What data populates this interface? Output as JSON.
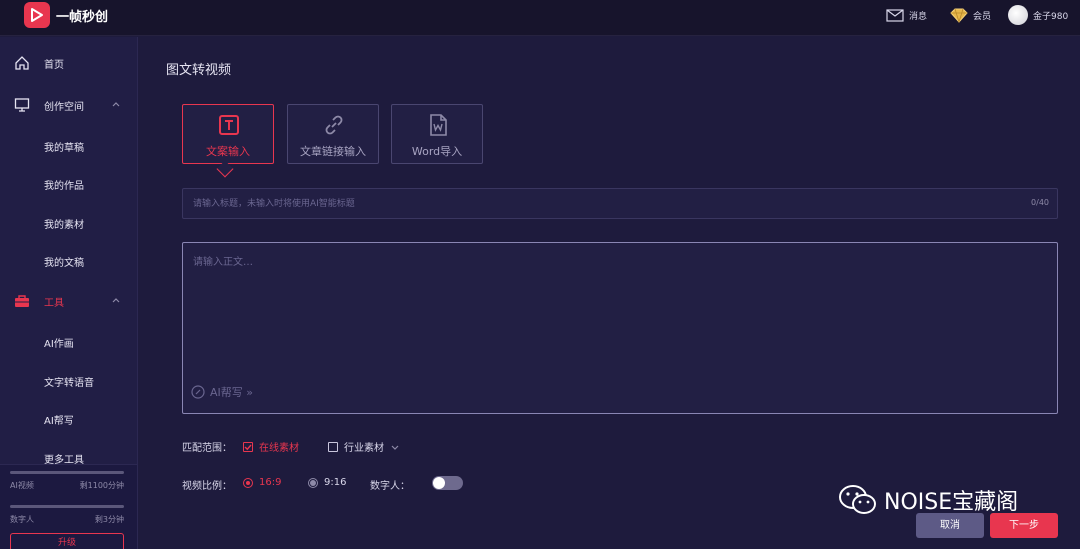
{
  "app": {
    "name": "一帧秒创"
  },
  "topbar": {
    "messages_label": "消息",
    "vip_label": "会员",
    "coins_label": "金子980"
  },
  "sidebar": {
    "items": [
      {
        "label": "首页",
        "icon": "home-icon"
      },
      {
        "label": "创作空间",
        "icon": "monitor-icon"
      },
      {
        "label": "我的草稿"
      },
      {
        "label": "我的作品"
      },
      {
        "label": "我的素材"
      },
      {
        "label": "我的文稿"
      },
      {
        "label": "工具",
        "icon": "toolbox-icon"
      },
      {
        "label": "AI作画"
      },
      {
        "label": "文字转语音"
      },
      {
        "label": "AI帮写"
      },
      {
        "label": "更多工具"
      }
    ],
    "quota": [
      {
        "label": "AI视频",
        "value": "剩1100分钟",
        "fill": 0.0
      },
      {
        "label": "数字人",
        "value": "剩3分钟",
        "fill": 0.0
      }
    ],
    "upgrade_label": "升级"
  },
  "main": {
    "title": "图文转视频",
    "tabs": [
      {
        "label": "文案输入",
        "icon": "text-icon",
        "active": true
      },
      {
        "label": "文章链接输入",
        "icon": "link-icon",
        "active": false
      },
      {
        "label": "Word导入",
        "icon": "word-file-icon",
        "active": false
      }
    ],
    "title_input": {
      "placeholder": "请输入标题，未输入时将使用AI智能标题",
      "count": "0/40"
    },
    "body_input": {
      "placeholder": "请输入正文…"
    },
    "ai_help_label": "AI帮写 »",
    "match_range": {
      "label": "匹配范围：",
      "options": [
        {
          "label": "在线素材",
          "checked": true
        },
        {
          "label": "行业素材",
          "checked": false
        }
      ]
    },
    "ratio": {
      "label": "视频比例：",
      "options": [
        {
          "label": "16:9",
          "selected": true
        },
        {
          "label": "9:16",
          "selected": false
        }
      ],
      "digital_human_label": "数字人：",
      "digital_human_on": false
    },
    "cancel_label": "取消",
    "next_label": "下一步"
  },
  "watermark": {
    "text": "NOISE宝藏阁"
  },
  "colors": {
    "accent": "#e8364f",
    "background": "#1e1b3d",
    "sidebar": "#211e45",
    "topbar": "#17142c"
  }
}
